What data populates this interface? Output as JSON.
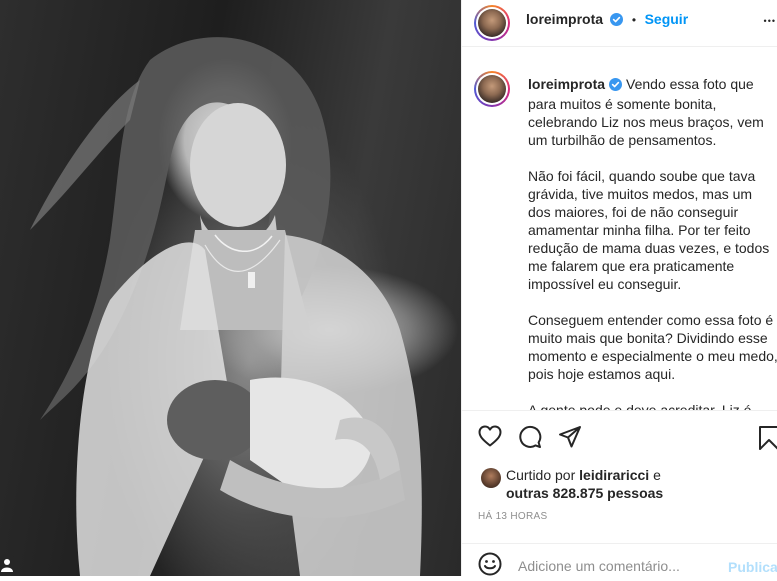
{
  "post": {
    "username": "loreimprota",
    "separator": "•",
    "follow_label": "Seguir",
    "more_label": "•••",
    "caption": "Vendo essa foto que para muitos é somente bonita, celebrando Liz nos meus braços, vem um turbilhão de pensamentos.\n\nNão foi fácil, quando soube que tava grávida, tive muitos medos, mas um dos maiores, foi de não conseguir amamentar minha filha. Por ter feito redução de mama duas vezes, e todos me falarem que era praticamente impossível eu conseguir.\n\nConseguem entender como essa foto é muito mais que bonita? Dividindo esse momento e especialmente o meu medo, pois hoje estamos aqui.\n\nA gente pode e deve acreditar. Liz é",
    "liked_prefix": "Curtido por",
    "liked_user": "leidiraricci",
    "liked_and": "e",
    "liked_others": "outras 828.875 pessoas",
    "timestamp": "HÁ 13 HORAS"
  },
  "comment": {
    "placeholder": "Adicione um comentário...",
    "publish_label": "Publicar"
  },
  "colors": {
    "accent": "#0095f6",
    "verified": "#3897f0",
    "publish_disabled": "#b2dffc",
    "border": "#efefef",
    "muted": "#8e8e8e"
  },
  "icons": [
    "verified-badge-icon",
    "heart-icon",
    "comment-icon",
    "share-icon",
    "bookmark-icon",
    "emoji-icon",
    "more-options-icon"
  ]
}
